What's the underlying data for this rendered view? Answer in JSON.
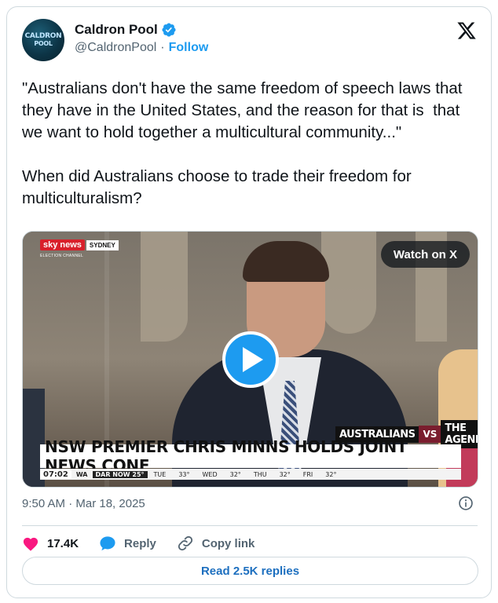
{
  "author": {
    "avatar_text_1": "CALDRON",
    "avatar_text_2": "POOL",
    "display_name": "Caldron Pool",
    "handle": "@CaldronPool",
    "separator": "·",
    "follow_label": "Follow",
    "verified": true
  },
  "platform_icon": "x-logo-icon",
  "tweet": {
    "text": "\"Australians don't have the same freedom of speech laws that they have in the United States, and the reason for that is  that we want to hold together a multicultural community...\"\n\nWhen did Australians choose to trade their freedom for multiculturalism?"
  },
  "media": {
    "channel_badge": "sky news",
    "channel_city": "SYDNEY",
    "channel_sub": "ELECTION CHANNEL",
    "watch_label": "Watch on X",
    "tag_left": "AUSTRALIANS",
    "tag_vs": "VS",
    "tag_right": "THE AGENDA",
    "headline": "NSW PREMIER CHRIS MINNS HOLDS JOINT NEWS CONF",
    "ticker": {
      "time": "07:02",
      "loc": "WA",
      "dar": "DAR NOW 25°",
      "segments": [
        "TUE",
        "33°",
        "WED",
        "32°",
        "THU",
        "32°",
        "FRI",
        "32°"
      ]
    }
  },
  "meta": {
    "timestamp": "9:50 AM · Mar 18, 2025"
  },
  "actions": {
    "likes": "17.4K",
    "reply_label": "Reply",
    "copy_label": "Copy link"
  },
  "replies_button": "Read 2.5K replies",
  "colors": {
    "accent": "#1d9bf0",
    "like": "#f91880",
    "text": "#0f1419",
    "muted": "#536471",
    "border": "#cfd9de"
  }
}
